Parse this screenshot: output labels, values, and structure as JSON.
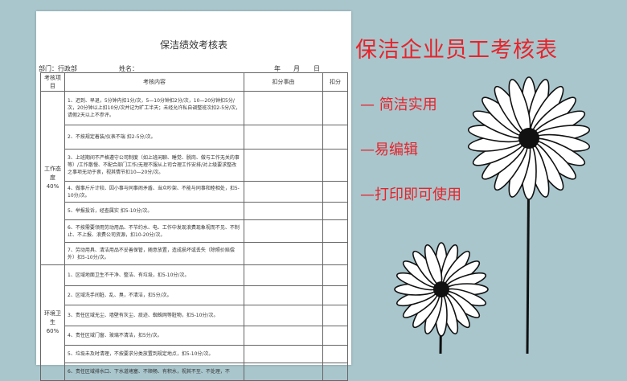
{
  "doc": {
    "title": "保洁绩效考核表",
    "dept_label": "部门：行政部",
    "name_label": "姓名：",
    "year": "年",
    "month": "月",
    "day": "日",
    "headers": [
      "考核项目",
      "考核内容",
      "扣分事由",
      "扣分"
    ],
    "sections": [
      {
        "category": "工作态度",
        "weight": "40%",
        "items": [
          "1、迟到、早退，5分钟内扣1分/次，5—10分钟扣2分/次，10—20分钟扣5分/次，20分钟以上扣10分/次并记为旷工半天；未经允许私自调整班次扣2-5分/次，请假2天以上不参评。",
          "2、不按规定着装/仪表不端 扣2-5分/次。",
          "3、上班期间不严格遵守公司制度（如上班闲聊、睡觉、脱岗、做与工作无关的事等）/工作散慢、不配合部门工作/无理不服从上司合理工作安排/对上级要求整改之事项无动于衷，视其情节扣10—20分/次。",
          "4、做事斤斤计较、因小事与同事闹矛盾、当众吵架、不能与同事和睦相处，扣5-10分/次。",
          "5、举报投诉，经查属实 扣5-10分/次。",
          "6、不按需要领用劳动用品、不节约水、电、工作中发现浪费现象视而不见、不制止、不上报、浪费公司资源，扣10-20分/次。",
          "7、劳动用具、清洁用品不妥善保管，随意放置，造成损坏或丢失（除照价赔偿外）扣5-10分/次。"
        ]
      },
      {
        "category": "环境卫生",
        "weight": "60%",
        "items": [
          "1、区域地面卫生不干净、整洁、有垃圾，扣5-10分/次。",
          "2、区域洗手间脏、乱、臭，不清洁，扣5分/次。",
          "3、责任区域无尘、墙壁有灰尘、痰迹、蜘蛛网等脏物，扣5-10分/次。",
          "4、责任区域门窗、玻璃不清洁，扣5分/次。",
          "5、垃圾未及时清理，不按要求分类放置到规定地点，扣5-10分/次。",
          "6、责任区域排水口、下水道堵塞、不顺畅、有积水，视其不至、不处理，不"
        ]
      }
    ]
  },
  "promo": {
    "title": "保洁企业员工考核表",
    "features": [
      "— 简洁实用",
      "—易编辑",
      "—打印即可使用"
    ],
    "color": "#e8232a"
  }
}
